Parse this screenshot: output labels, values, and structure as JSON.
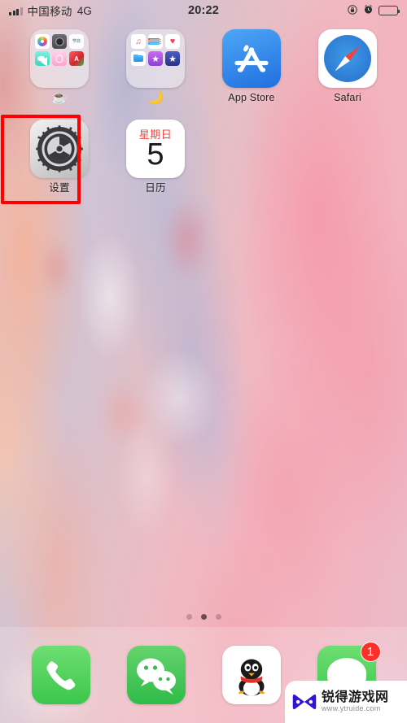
{
  "status_bar": {
    "carrier": "中国移动",
    "network": "4G",
    "time": "20:22",
    "icons": [
      "signal-bars-icon",
      "rotation-lock-icon",
      "alarm-clock-icon",
      "battery-icon"
    ]
  },
  "home_screen": {
    "apps": [
      {
        "id": "folder-1",
        "label": "☕",
        "type": "folder",
        "contents": [
          "Photos",
          "Camera",
          "节日",
          "FaceTime",
          "Photo Booth",
          "Clips"
        ]
      },
      {
        "id": "folder-2",
        "label": "🌙",
        "type": "folder",
        "contents": [
          "Music",
          "Reminders",
          "Health",
          "Files",
          "iTunes Store",
          "iMovie"
        ]
      },
      {
        "id": "app-store",
        "label": "App Store",
        "type": "app"
      },
      {
        "id": "safari",
        "label": "Safari",
        "type": "app"
      },
      {
        "id": "settings",
        "label": "设置",
        "type": "app",
        "highlighted": true
      },
      {
        "id": "calendar",
        "label": "日历",
        "type": "app",
        "weekday": "星期日",
        "date": "5"
      }
    ]
  },
  "page_dots": {
    "count": 3,
    "active_index": 1
  },
  "dock": {
    "apps": [
      {
        "id": "phone",
        "label": "电话"
      },
      {
        "id": "wechat",
        "label": "微信"
      },
      {
        "id": "qq",
        "label": "QQ"
      },
      {
        "id": "messages",
        "label": "信息",
        "badge": "1"
      }
    ]
  },
  "watermark": {
    "name": "锐得游戏网",
    "url": "www.ytruide.com"
  },
  "colors": {
    "highlight": "#ff0000",
    "badge": "#fc3028",
    "calendar_red": "#f4453c",
    "app_store_blue": "#1f6fe0",
    "wechat_green": "#2fbb48",
    "watermark_logo": "#2c15d8"
  }
}
